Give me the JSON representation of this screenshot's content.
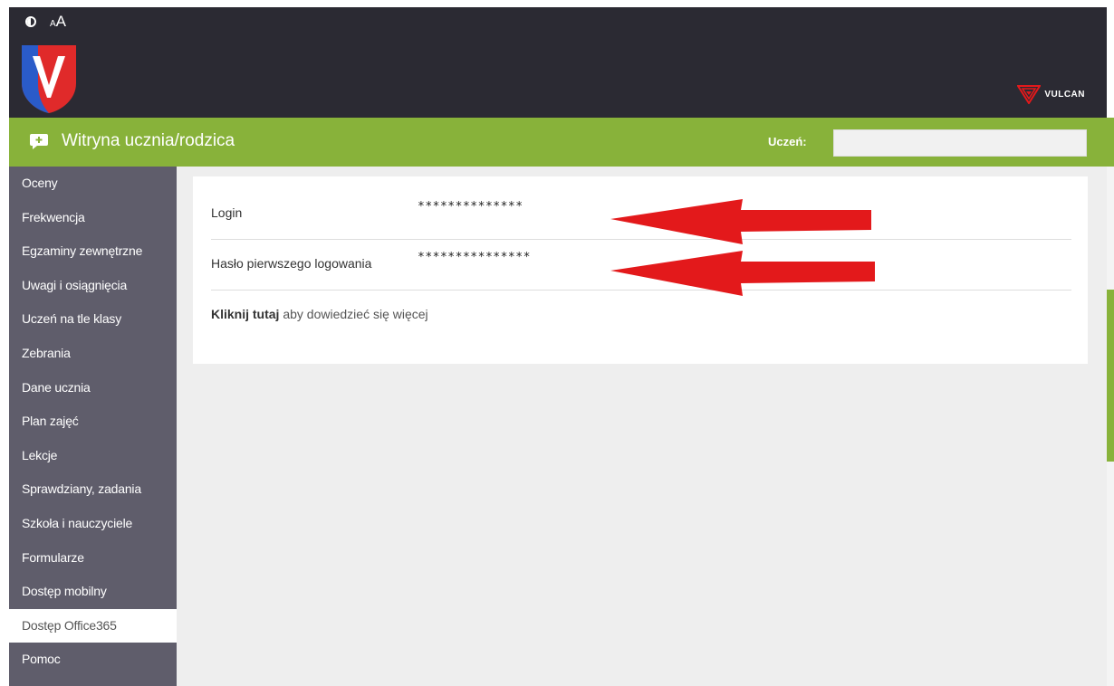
{
  "colors": {
    "header_bg": "#2b2a33",
    "accent_green": "#88b23a",
    "sidebar_bg": "#5f5d6b",
    "content_bg": "#eeeeee",
    "arrow_red": "#e3191b"
  },
  "header": {
    "contrast_icon": "contrast-icon",
    "font_size_small": "A",
    "font_size_big": "A",
    "vulcan_text": "VULCAN"
  },
  "app": {
    "title": "Witryna ucznia/rodzica",
    "student_label": "Uczeń:",
    "student_value": ""
  },
  "sidebar": {
    "items": [
      {
        "label": "Oceny"
      },
      {
        "label": "Frekwencja"
      },
      {
        "label": "Egzaminy zewnętrzne"
      },
      {
        "label": "Uwagi i osiągnięcia"
      },
      {
        "label": "Uczeń na tle klasy"
      },
      {
        "label": "Zebrania"
      },
      {
        "label": "Dane ucznia"
      },
      {
        "label": "Plan zajęć"
      },
      {
        "label": "Lekcje"
      },
      {
        "label": "Sprawdziany, zadania"
      },
      {
        "label": "Szkoła i nauczyciele"
      },
      {
        "label": "Formularze"
      },
      {
        "label": "Dostęp mobilny"
      },
      {
        "label": "Dostęp Office365"
      },
      {
        "label": "Pomoc"
      }
    ]
  },
  "content": {
    "login_label": "Login",
    "login_value": "**************",
    "password_label": "Hasło pierwszego logowania",
    "password_value": "***************",
    "more_link": "Kliknij tutaj",
    "more_text": " aby dowiedzieć się więcej"
  }
}
